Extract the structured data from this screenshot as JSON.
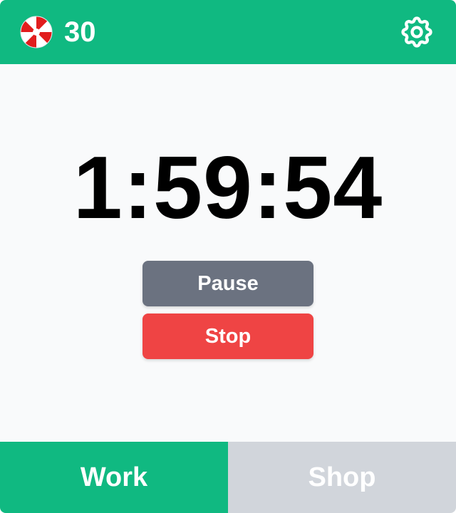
{
  "header": {
    "points_icon": "peppermint-candy-icon",
    "points_value": "30",
    "settings_icon": "gear-icon"
  },
  "timer": {
    "display": "1:59:54"
  },
  "controls": {
    "pause_label": "Pause",
    "stop_label": "Stop"
  },
  "tabs": [
    {
      "label": "Work",
      "active": true
    },
    {
      "label": "Shop",
      "active": false
    }
  ],
  "colors": {
    "brand_green": "#10b981",
    "pause_gray": "#6b7280",
    "stop_red": "#ef4444",
    "inactive_tab": "#d1d5db",
    "background": "#f9fafb"
  }
}
